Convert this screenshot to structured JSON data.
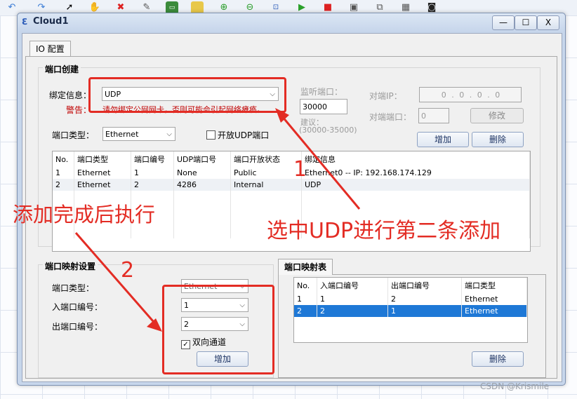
{
  "window": {
    "title": "Cloud1",
    "minimize": "—",
    "maximize": "☐",
    "close": "X"
  },
  "tab": {
    "label": "IO 配置"
  },
  "port_creation": {
    "section_title": "端口创建",
    "bind_label": "绑定信息：",
    "bind_value": "UDP",
    "warning_label": "警告：",
    "warning_text": "请勿绑定公网网卡，否则可能会引起网络瘫痪。",
    "port_type_label": "端口类型：",
    "port_type_value": "Ethernet",
    "open_udp_label": "开放UDP端口",
    "listen_port_label": "监听端口：",
    "listen_port_value": "30000",
    "suggest_label": "建议：",
    "suggest_range": "(30000-35000)",
    "peer_ip_label": "对端IP：",
    "peer_ip_value": "0 . 0 . 0 . 0",
    "peer_port_label": "对端端口：",
    "peer_port_value": "0",
    "modify_button": "修改",
    "add_button": "增加",
    "delete_button": "删除",
    "table": {
      "headers": [
        "No.",
        "端口类型",
        "端口编号",
        "UDP端口号",
        "端口开放状态",
        "绑定信息"
      ],
      "rows": [
        [
          "1",
          "Ethernet",
          "1",
          "None",
          "Public",
          "Ethernet0 -- IP: 192.168.174.129"
        ],
        [
          "2",
          "Ethernet",
          "2",
          "4286",
          "Internal",
          "UDP"
        ]
      ]
    }
  },
  "port_mapping": {
    "section_title": "端口映射设置",
    "port_type_label": "端口类型：",
    "port_type_value": "Ethernet",
    "in_port_label": "入端口编号：",
    "in_port_value": "1",
    "out_port_label": "出端口编号：",
    "out_port_value": "2",
    "bidirectional_label": "双向通道",
    "add_button": "增加"
  },
  "mapping_table": {
    "tab_label": "端口映射表",
    "headers": [
      "No.",
      "入端口编号",
      "出端口编号",
      "端口类型"
    ],
    "rows": [
      [
        "1",
        "1",
        "2",
        "Ethernet"
      ],
      [
        "2",
        "2",
        "1",
        "Ethernet"
      ]
    ],
    "delete_button": "删除"
  },
  "annotations": {
    "num1": "1",
    "text1": "选中UDP进行第二条添加",
    "num2": "2",
    "text2": "添加完成后执行"
  },
  "watermark": "CSDN @Krismile",
  "colors": {
    "annotation_red": "#e32c24",
    "selection_blue": "#1e78d6",
    "warning_red": "#c00000"
  }
}
